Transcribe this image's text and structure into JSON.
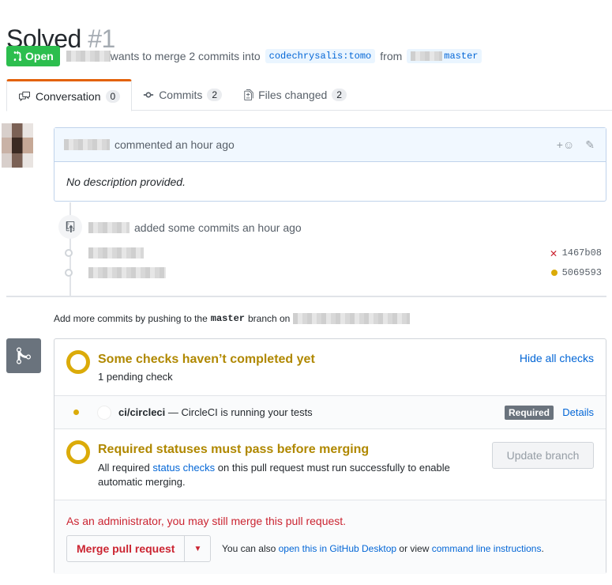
{
  "pr": {
    "title": "Solved",
    "number": "#1",
    "state": "Open",
    "merge_text": "wants to merge 2 commits into",
    "head_branch": "codechrysalis:tomo",
    "from_text": "from",
    "base_branch": "master"
  },
  "tabs": [
    {
      "label": "Conversation",
      "count": "0"
    },
    {
      "label": "Commits",
      "count": "2"
    },
    {
      "label": "Files changed",
      "count": "2"
    }
  ],
  "comment": {
    "action": "commented an hour ago",
    "body": "No description provided."
  },
  "push_event": {
    "text": "added some commits an hour ago",
    "commits": [
      {
        "sha": "1467b08",
        "status": "failure"
      },
      {
        "sha": "5069593",
        "status": "pending"
      }
    ]
  },
  "add_more": {
    "prefix": "Add more commits by pushing to the",
    "branch": "master",
    "suffix": "branch on"
  },
  "checks": {
    "heading": "Some checks haven’t completed yet",
    "sub": "1 pending check",
    "hide_label": "Hide all checks",
    "check_name": "ci/circleci",
    "check_desc": "— CircleCI is running your tests",
    "required_badge": "Required",
    "details_label": "Details"
  },
  "required": {
    "heading": "Required statuses must pass before merging",
    "line1_a": "All required",
    "line1_link": "status checks",
    "line1_b": "on this pull request must run successfully to enable",
    "line2": "automatic merging.",
    "update_label": "Update branch"
  },
  "merge": {
    "admin_text": "As an administrator, you may still merge this pull request.",
    "button_label": "Merge pull request",
    "also_a": "You can also",
    "desktop_link": "open this in GitHub Desktop",
    "also_b": "or view",
    "cli_link": "command line instructions",
    "also_c": "."
  },
  "colors": {
    "open_green": "#2cbe4e",
    "pending_yellow": "#dbab09",
    "danger_red": "#cb2431",
    "link_blue": "#0366d6"
  }
}
